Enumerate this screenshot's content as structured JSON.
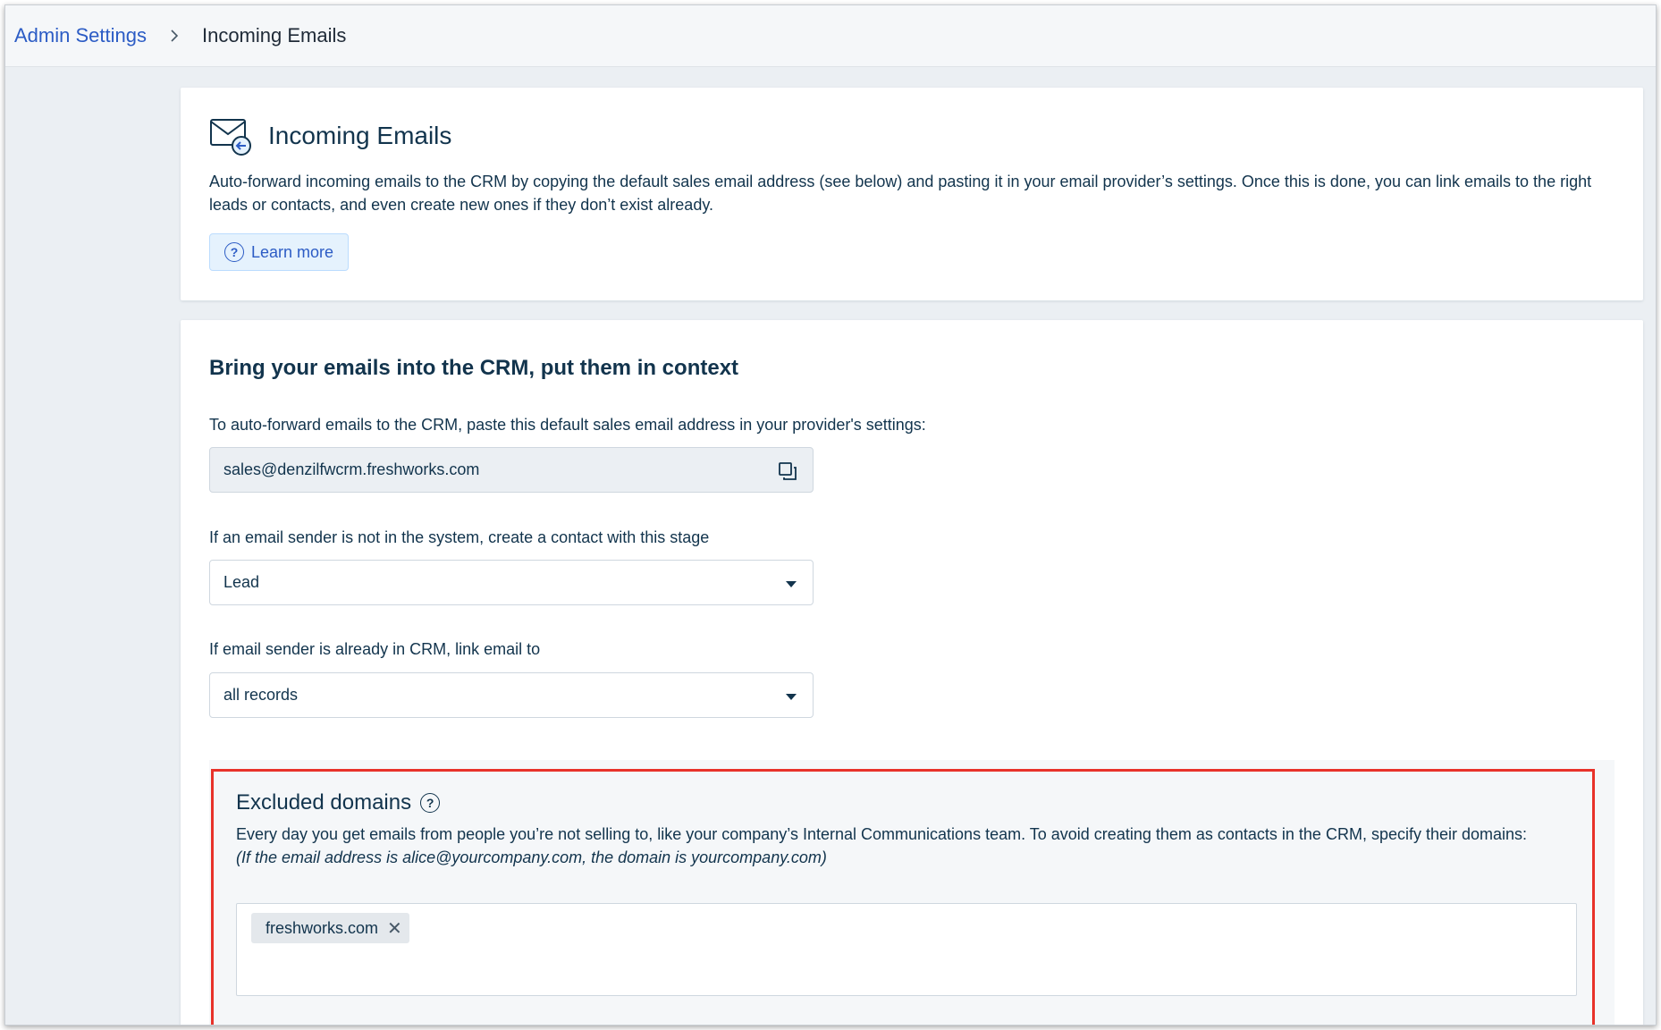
{
  "breadcrumb": {
    "root": "Admin Settings",
    "current": "Incoming Emails"
  },
  "intro": {
    "title": "Incoming Emails",
    "description": "Auto-forward incoming emails to the CRM by copying the default sales email address (see below) and pasting it in your email provider’s settings. Once this is done, you can link emails to the right leads or contacts, and even create new ones if they don’t exist already.",
    "learn_more": "Learn more"
  },
  "settings": {
    "title": "Bring your emails into the CRM, put them in context",
    "email_label": "To auto-forward emails to the CRM, paste this default sales email address in your provider's settings:",
    "email_value": "sales@denzilfwcrm.freshworks.com",
    "stage_label": "If an email sender is not in the system, create a contact with this stage",
    "stage_value": "Lead",
    "link_label": "If email sender is already in CRM, link email to",
    "link_value": "all records"
  },
  "excluded": {
    "title": "Excluded domains",
    "description": "Every day you get emails from people you’re not selling to, like your company’s Internal Communications team. To avoid creating them as contacts in the CRM, specify their domains:",
    "example": "(If the email address is alice@yourcompany.com, the domain is yourcompany.com)",
    "tags": [
      "freshworks.com"
    ]
  },
  "colors": {
    "accent": "#2c5cc5",
    "highlight": "#e8322a"
  }
}
